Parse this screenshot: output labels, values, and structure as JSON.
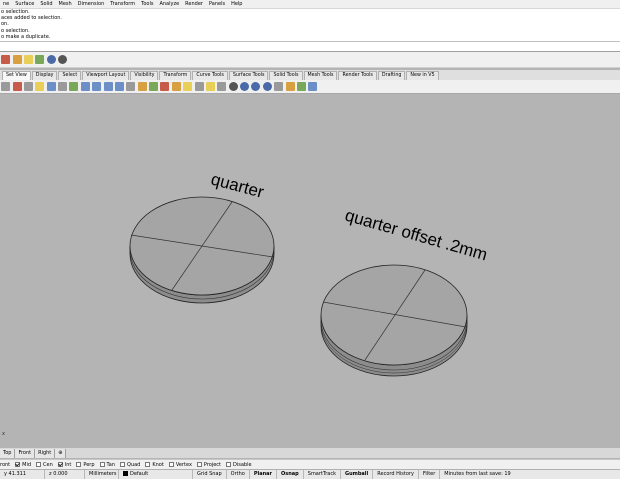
{
  "menu": [
    "ne",
    "Surface",
    "Solid",
    "Mesh",
    "Dimension",
    "Transform",
    "Tools",
    "Analyze",
    "Render",
    "Panels",
    "Help"
  ],
  "command_history": [
    "o selection.",
    "aces added to selection.",
    "on.",
    "o selection.",
    "o make a duplicate."
  ],
  "toolbar_tabs": [
    "Set View",
    "Display",
    "Select",
    "Viewport Layout",
    "Visibility",
    "Transform",
    "Curve Tools",
    "Surface Tools",
    "Solid Tools",
    "Mesh Tools",
    "Render Tools",
    "Drafting",
    "New in V5"
  ],
  "viewport": {
    "label_quarter": "quarter",
    "label_offset": "quarter offset .2mm",
    "axis_label": "x"
  },
  "viewport_tabs": [
    "Top",
    "Front",
    "Right",
    "⊕"
  ],
  "osnaps": [
    {
      "label": "ront",
      "checked": false
    },
    {
      "label": "Mid",
      "checked": true
    },
    {
      "label": "Cen",
      "checked": false
    },
    {
      "label": "Int",
      "checked": true
    },
    {
      "label": "Perp",
      "checked": false
    },
    {
      "label": "Tan",
      "checked": false
    },
    {
      "label": "Quad",
      "checked": false
    },
    {
      "label": "Knot",
      "checked": false
    },
    {
      "label": "Vertex",
      "checked": false
    },
    {
      "label": "Project",
      "checked": false
    },
    {
      "label": "Disable",
      "checked": false
    }
  ],
  "status": {
    "x": "y 41.311",
    "z": "z 0.000",
    "units": "Millimeters",
    "layer": "Default",
    "grid_snap": "Grid Snap",
    "ortho": "Ortho",
    "planar": "Planar",
    "osnap": "Osnap",
    "smarttrack": "SmartTrack",
    "gumball": "Gumball",
    "record_history": "Record History",
    "filter": "Filter",
    "minutes": "Minutes from last save: 19"
  },
  "colors": {
    "viewport": "#b4b4b4",
    "coin_top": "#a3a3a3",
    "coin_rim": "#8c8c8c"
  }
}
